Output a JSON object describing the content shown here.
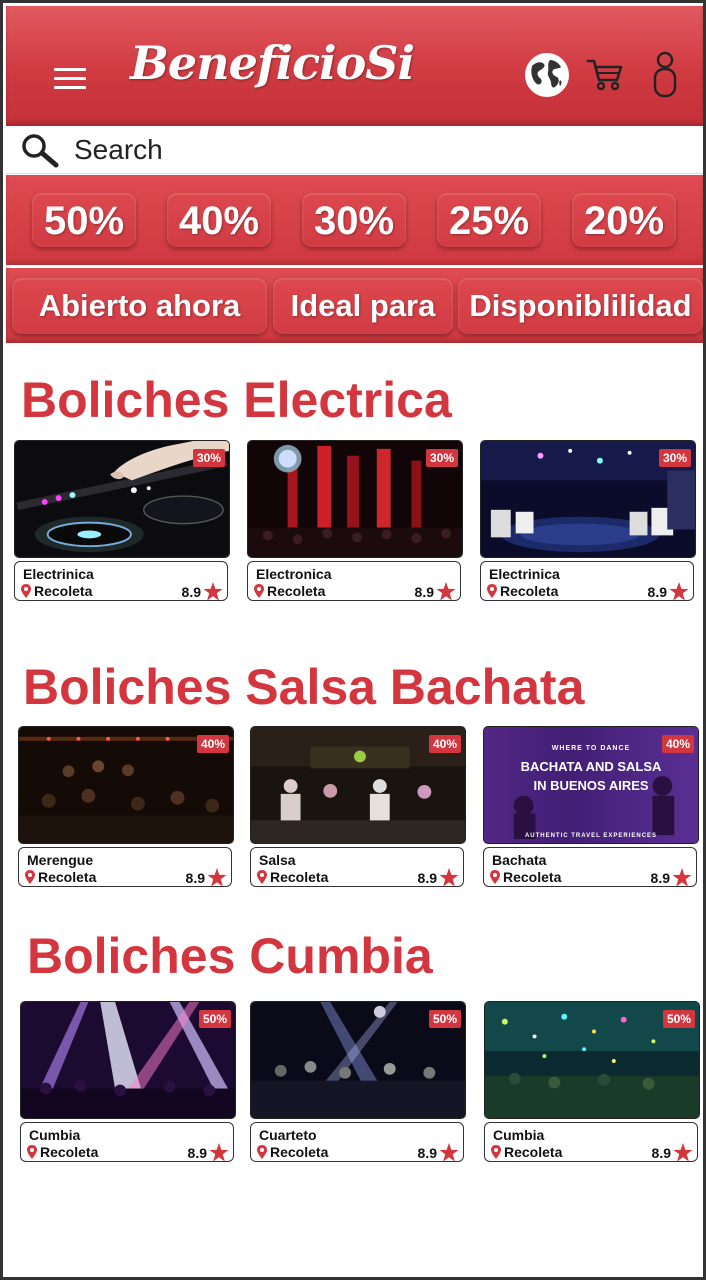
{
  "header": {
    "logo": "BeneficioSi"
  },
  "search": {
    "placeholder": "Search"
  },
  "discounts": [
    "50%",
    "40%",
    "30%",
    "25%",
    "20%"
  ],
  "filters": [
    "Abierto ahora",
    "Ideal para",
    "Disponiblilidad"
  ],
  "sections": [
    {
      "title": "Boliches Electrica",
      "cards": [
        {
          "name": "Electrinica",
          "location": "Recoleta",
          "rating": "8.9",
          "discount": "30%"
        },
        {
          "name": "Electronica",
          "location": "Recoleta",
          "rating": "8.9",
          "discount": "30%"
        },
        {
          "name": "Electrinica",
          "location": "Recoleta",
          "rating": "8.9",
          "discount": "30%"
        }
      ]
    },
    {
      "title": "Boliches Salsa Bachata",
      "cards": [
        {
          "name": "Merengue",
          "location": "Recoleta",
          "rating": "8.9",
          "discount": "40%"
        },
        {
          "name": "Salsa",
          "location": "Recoleta",
          "rating": "8.9",
          "discount": "40%"
        },
        {
          "name": "Bachata",
          "location": "Recoleta",
          "rating": "8.9",
          "discount": "40%",
          "image_text": {
            "line1": "WHERE TO DANCE",
            "line2": "BACHATA AND SALSA",
            "line3": "IN BUENOS AIRES",
            "line4": "AUTHENTIC TRAVEL EXPERIENCES"
          }
        }
      ]
    },
    {
      "title": "Boliches Cumbia",
      "cards": [
        {
          "name": "Cumbia",
          "location": "Recoleta",
          "rating": "8.9",
          "discount": "50%"
        },
        {
          "name": "Cuarteto",
          "location": "Recoleta",
          "rating": "8.9",
          "discount": "50%"
        },
        {
          "name": "Cumbia",
          "location": "Recoleta",
          "rating": "8.9",
          "discount": "50%"
        }
      ]
    }
  ],
  "colors": {
    "brand_red": "#d3363e",
    "header_red": "#d03a41"
  },
  "icons": [
    "menu-icon",
    "globe-icon",
    "cart-icon",
    "user-icon",
    "search-icon",
    "pin-icon",
    "star-icon"
  ]
}
